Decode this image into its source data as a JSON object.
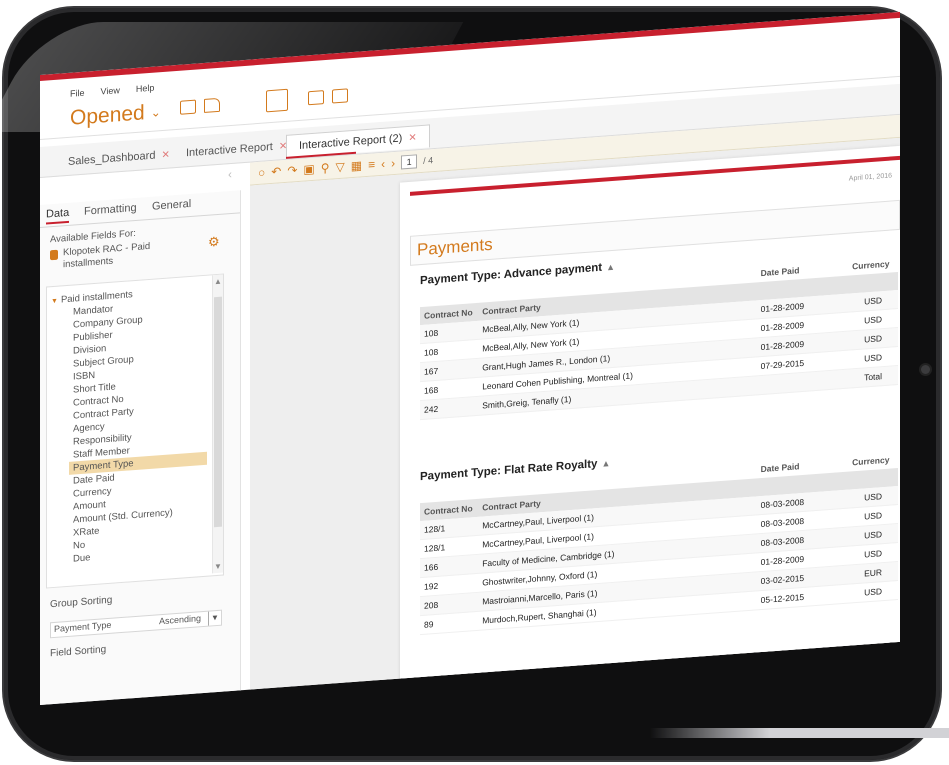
{
  "menu": {
    "file": "File",
    "view": "View",
    "help": "Help"
  },
  "app": {
    "opened_label": "Opened"
  },
  "tabs": [
    {
      "label": "Sales_Dashboard"
    },
    {
      "label": "Interactive Report"
    },
    {
      "label": "Interactive Report (2)"
    }
  ],
  "pager": {
    "current": "1",
    "total": "/ 4"
  },
  "panel": {
    "tabs": [
      "Data",
      "Formatting",
      "General"
    ],
    "available_fields_label": "Available Fields For:",
    "source_line1": "Klopotek RAC - Paid",
    "source_line2": "installments",
    "group_label": "Paid installments",
    "fields": [
      "Mandator",
      "Company Group",
      "Publisher",
      "Division",
      "Subject Group",
      "ISBN",
      "Short Title",
      "Contract No",
      "Contract Party",
      "Agency",
      "Responsibility",
      "Staff Member",
      "Payment Type",
      "Date Paid",
      "Currency",
      "Amount",
      "Amount (Std. Currency)",
      "XRate",
      "No",
      "Due"
    ],
    "selected_field": "Payment Type",
    "group_sorting_label": "Group Sorting",
    "sort_field": "Payment Type",
    "sort_order": "Ascending",
    "field_sorting_label": "Field Sorting"
  },
  "report": {
    "date": "April 01, 2016",
    "title": "Payments",
    "columns": {
      "no": "Contract No",
      "party": "Contract Party",
      "date": "Date Paid",
      "currency": "Currency"
    },
    "sections": [
      {
        "title": "Payment Type: Advance payment",
        "rows": [
          {
            "no": "108",
            "party": "McBeal,Ally, New York (1)",
            "date": "01-28-2009",
            "currency": "USD"
          },
          {
            "no": "108",
            "party": "McBeal,Ally, New York (1)",
            "date": "01-28-2009",
            "currency": "USD"
          },
          {
            "no": "167",
            "party": "Grant,Hugh James R., London (1)",
            "date": "01-28-2009",
            "currency": "USD"
          },
          {
            "no": "168",
            "party": "Leonard Cohen Publishing, Montreal (1)",
            "date": "07-29-2015",
            "currency": "USD"
          },
          {
            "no": "242",
            "party": "Smith,Greig, Tenafly (1)",
            "date": "",
            "currency": "Total"
          }
        ]
      },
      {
        "title": "Payment Type: Flat Rate Royalty",
        "rows": [
          {
            "no": "128/1",
            "party": "McCartney,Paul, Liverpool (1)",
            "date": "08-03-2008",
            "currency": "USD"
          },
          {
            "no": "128/1",
            "party": "McCartney,Paul, Liverpool (1)",
            "date": "08-03-2008",
            "currency": "USD"
          },
          {
            "no": "166",
            "party": "Faculty of Medicine, Cambridge (1)",
            "date": "08-03-2008",
            "currency": "USD"
          },
          {
            "no": "192",
            "party": "Ghostwriter,Johnny, Oxford (1)",
            "date": "01-28-2009",
            "currency": "USD"
          },
          {
            "no": "208",
            "party": "Mastroianni,Marcello, Paris (1)",
            "date": "03-02-2015",
            "currency": "EUR"
          },
          {
            "no": "89",
            "party": "Murdoch,Rupert, Shanghai (1)",
            "date": "05-12-2015",
            "currency": "USD"
          }
        ]
      }
    ]
  },
  "colors": {
    "accent": "#c8202e",
    "brand_orange": "#d37a1d",
    "tablet": "#0f0f10"
  }
}
